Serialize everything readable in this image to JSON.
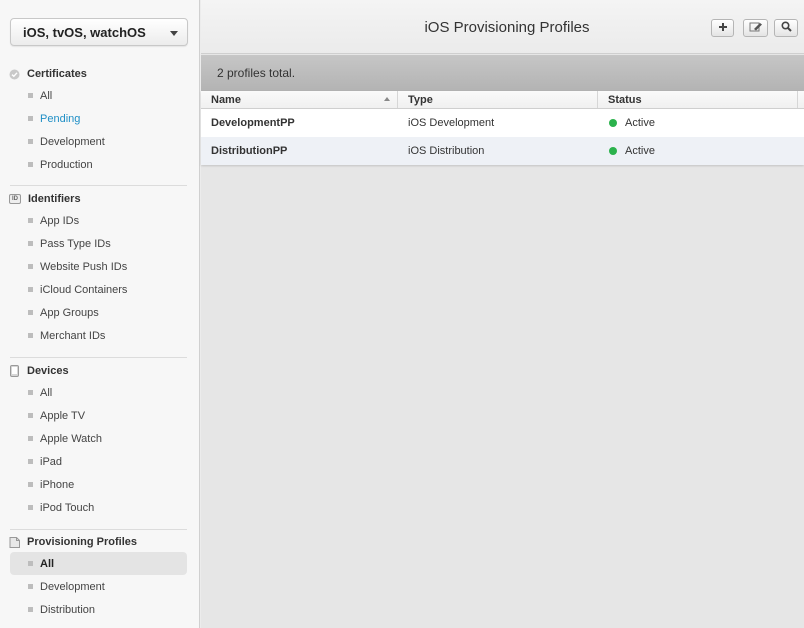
{
  "platform_select": {
    "value": "iOS, tvOS, watchOS"
  },
  "sidebar": {
    "certificates": {
      "title": "Certificates",
      "items": [
        "All",
        "Pending",
        "Development",
        "Production"
      ]
    },
    "identifiers": {
      "title": "Identifiers",
      "badge": "ID",
      "items": [
        "App IDs",
        "Pass Type IDs",
        "Website Push IDs",
        "iCloud Containers",
        "App Groups",
        "Merchant IDs"
      ]
    },
    "devices": {
      "title": "Devices",
      "items": [
        "All",
        "Apple TV",
        "Apple Watch",
        "iPad",
        "iPhone",
        "iPod Touch"
      ]
    },
    "provisioning": {
      "title": "Provisioning Profiles",
      "items": [
        "All",
        "Development",
        "Distribution"
      ]
    }
  },
  "header": {
    "title": "iOS Provisioning Profiles"
  },
  "summary": "2 profiles total.",
  "table": {
    "columns": [
      "Name",
      "Type",
      "Status"
    ],
    "rows": [
      {
        "name": "DevelopmentPP",
        "type": "iOS Development",
        "status": "Active"
      },
      {
        "name": "DistributionPP",
        "type": "iOS Distribution",
        "status": "Active"
      }
    ]
  },
  "colors": {
    "link": "#1f8fc6",
    "active_status": "#2bb24c"
  }
}
